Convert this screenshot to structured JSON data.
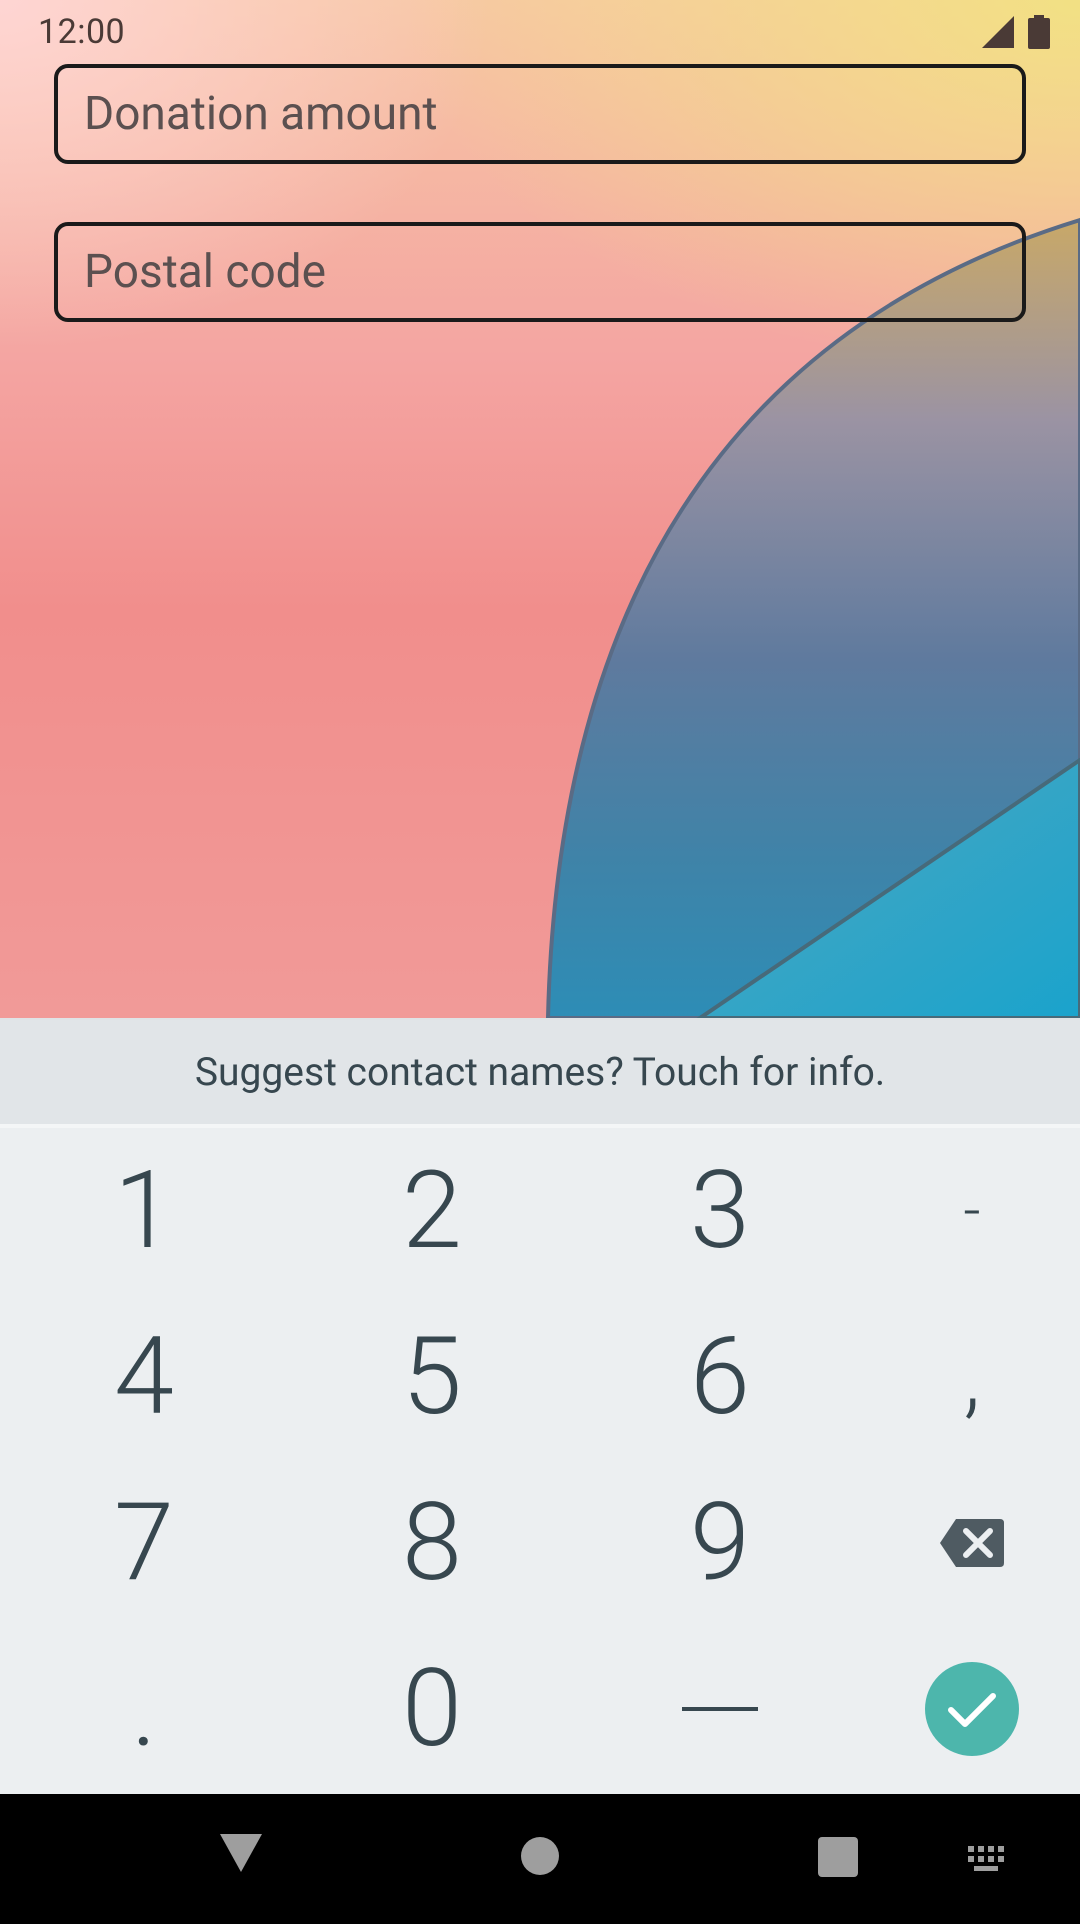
{
  "status_bar": {
    "time": "12:00",
    "icons": [
      "signal-icon",
      "battery-icon"
    ]
  },
  "form": {
    "donation_placeholder": "Donation amount",
    "postal_placeholder": "Postal code"
  },
  "keyboard": {
    "suggestion": "Suggest contact names? Touch for info.",
    "rows": [
      [
        "1",
        "2",
        "3",
        "-"
      ],
      [
        "4",
        "5",
        "6",
        ","
      ],
      [
        "7",
        "8",
        "9",
        "backspace"
      ],
      [
        ".",
        "0",
        "space",
        "done"
      ]
    ],
    "labels": {
      "k1": "1",
      "k2": "2",
      "k3": "3",
      "dash": "-",
      "k4": "4",
      "k5": "5",
      "k6": "6",
      "comma": ",",
      "k7": "7",
      "k8": "8",
      "k9": "9",
      "period": ".",
      "k0": "0"
    },
    "accent_color": "#4db6ac"
  },
  "nav_bar": {
    "buttons": [
      "back-icon",
      "home-icon",
      "recents-icon",
      "keyboard-switch-icon"
    ]
  }
}
